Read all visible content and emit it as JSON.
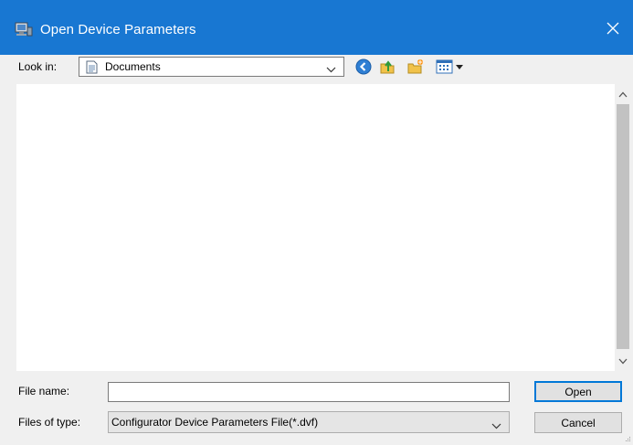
{
  "window": {
    "title": "Open Device Parameters",
    "title_icon": "device-computer-icon",
    "close_icon": "close-icon"
  },
  "toolbar": {
    "lookin_label": "Look in:",
    "lookin_value": "Documents",
    "lookin_icon": "documents-folder-icon",
    "buttons": [
      "back-icon",
      "up-folder-icon",
      "new-folder-icon",
      "view-menu-icon"
    ]
  },
  "file_list": {
    "items": []
  },
  "form": {
    "filename_label": "File name:",
    "filename_value": "",
    "filetype_label": "Files of type:",
    "filetype_value": "Configurator Device Parameters File(*.dvf)"
  },
  "buttons": {
    "open_label": "Open",
    "cancel_label": "Cancel"
  },
  "colors": {
    "titlebar": "#1877d2",
    "default_button_border": "#0078d7"
  }
}
